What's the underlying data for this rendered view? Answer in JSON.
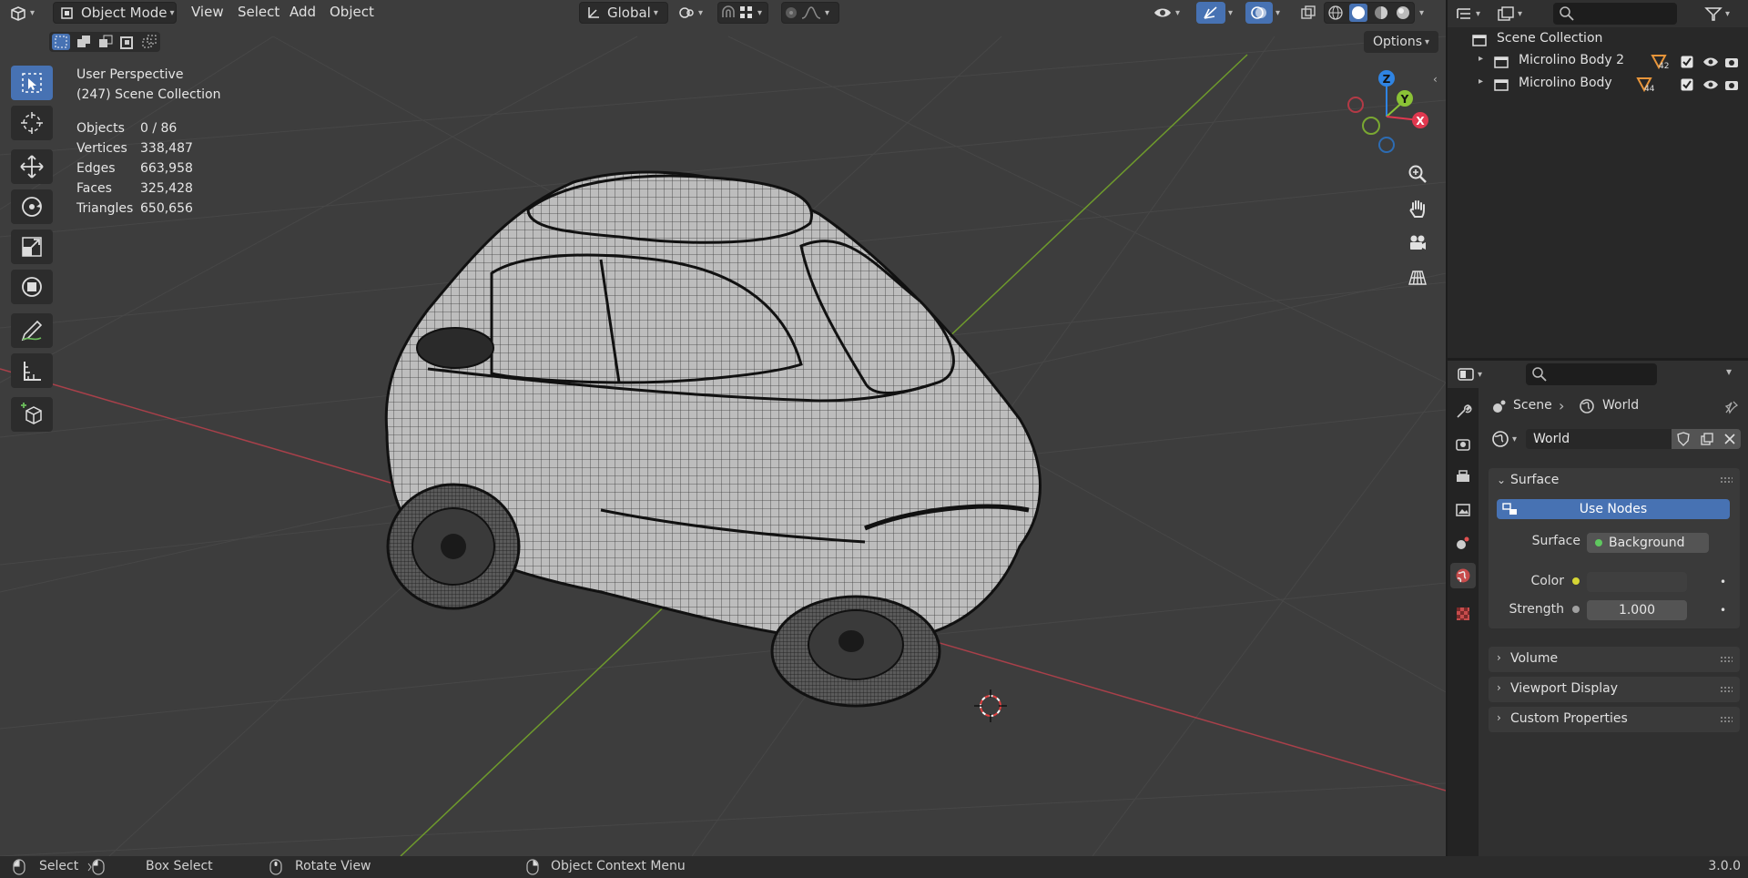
{
  "header": {
    "editor_type_icon": "3d-viewport-icon",
    "mode": "Object Mode",
    "menus": [
      "View",
      "Select",
      "Add",
      "Object"
    ],
    "orientation": "Global",
    "options_label": "Options"
  },
  "overlay": {
    "view_name": "User Perspective",
    "collection_info": "(247) Scene Collection",
    "stats": [
      {
        "label": "Objects",
        "value": "0 / 86"
      },
      {
        "label": "Vertices",
        "value": "338,487"
      },
      {
        "label": "Edges",
        "value": "663,958"
      },
      {
        "label": "Faces",
        "value": "325,428"
      },
      {
        "label": "Triangles",
        "value": "650,656"
      }
    ]
  },
  "toolbar": {
    "tools": [
      "select-box-tool",
      "cursor-tool",
      "move-tool",
      "rotate-tool",
      "scale-tool",
      "transform-tool",
      "annotate-tool",
      "measure-tool",
      "add-cube-tool"
    ],
    "active": "select-box-tool"
  },
  "gizmo": {
    "x": "X",
    "y": "Y",
    "z": "Z",
    "x_color": "#e0384f",
    "y_color": "#8bc236",
    "z_color": "#2f84e3"
  },
  "outliner": {
    "root": "Scene Collection",
    "items": [
      {
        "name": "Microlino Body 2",
        "count": "42"
      },
      {
        "name": "Microlino Body",
        "count": "44"
      }
    ]
  },
  "properties": {
    "breadcrumb": [
      "Scene",
      "World"
    ],
    "world_name": "World",
    "panels": {
      "surface": "Surface",
      "use_nodes": "Use Nodes",
      "surface_label": "Surface",
      "surface_value": "Background",
      "color_label": "Color",
      "strength_label": "Strength",
      "strength_value": "1.000",
      "volume": "Volume",
      "viewport_display": "Viewport Display",
      "custom_properties": "Custom Properties"
    }
  },
  "status": {
    "select": "Select",
    "box_select": "Box Select",
    "rotate_view": "Rotate View",
    "context_menu": "Object Context Menu",
    "version": "3.0.0"
  },
  "colors": {
    "accent": "#4772b3",
    "x_axis": "#c0474a",
    "y_axis": "#7aa832"
  }
}
